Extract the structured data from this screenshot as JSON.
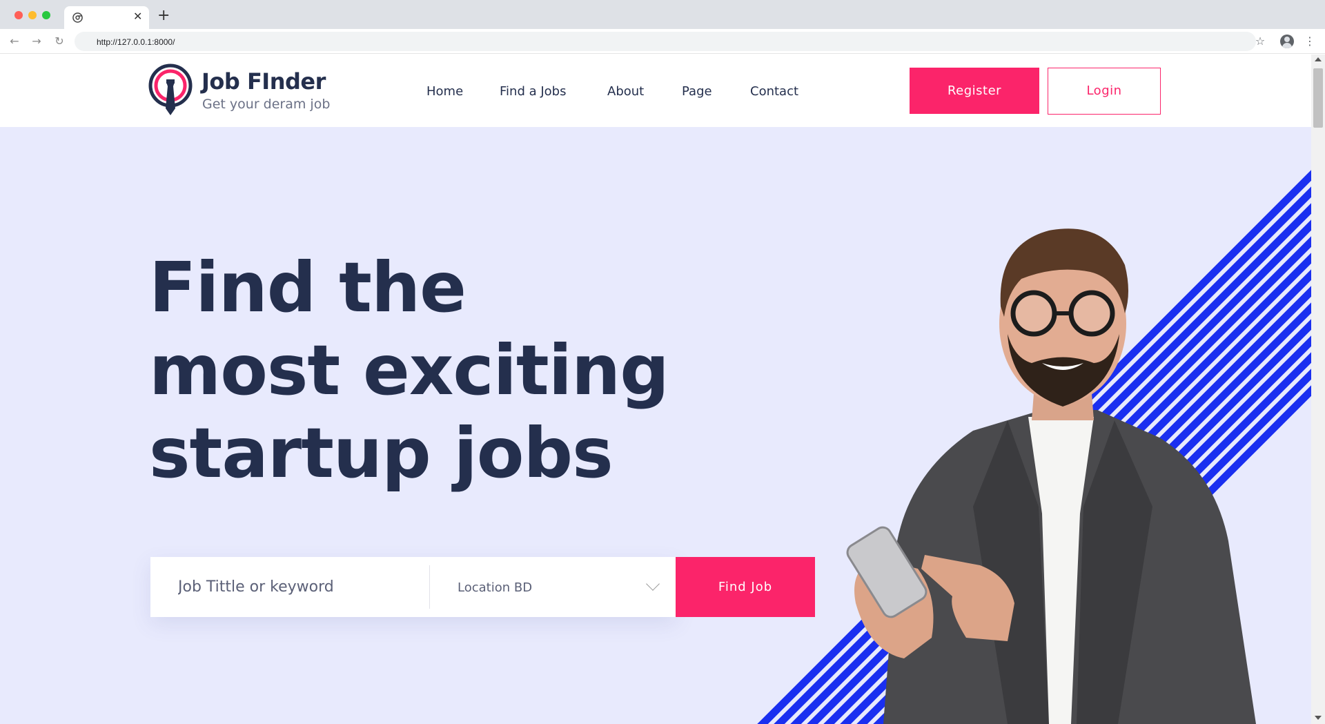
{
  "browser": {
    "url": "http://127.0.0.1:8000/",
    "new_tab_label": "+",
    "tab_close_label": "✕"
  },
  "brand": {
    "title": "Job FInder",
    "tagline": "Get your deram job",
    "colors": {
      "primary": "#fb246a",
      "dark": "#242f4d",
      "stripe": "#1a2ff0",
      "hero_bg": "#e8eafd"
    }
  },
  "nav": {
    "items": [
      "Home",
      "Find a Jobs",
      "About",
      "Page",
      "Contact"
    ]
  },
  "auth": {
    "register_label": "Register",
    "login_label": "Login"
  },
  "hero": {
    "title_lines": [
      "Find the",
      "most exciting",
      "startup jobs"
    ]
  },
  "search": {
    "keyword_placeholder": "Job Tittle or keyword",
    "location_value": "Location BD",
    "submit_label": "Find Job"
  },
  "icons": {
    "back": "back-arrow-icon",
    "forward": "forward-arrow-icon",
    "reload": "reload-icon",
    "bookmark": "star-icon",
    "profile": "profile-icon",
    "menu": "menu-icon"
  }
}
